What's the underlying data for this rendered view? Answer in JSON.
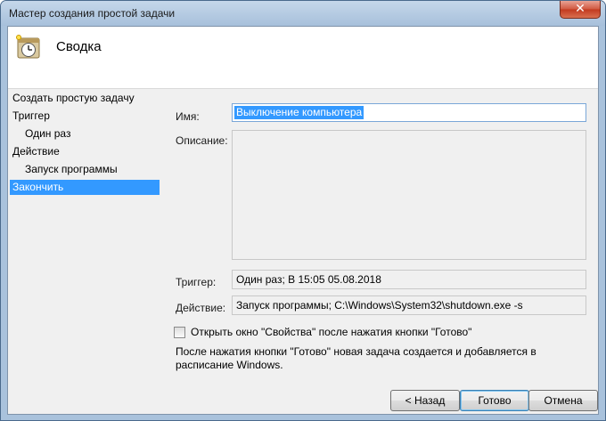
{
  "window": {
    "title": "Мастер создания простой задачи",
    "close_label": "✕"
  },
  "header": {
    "title": "Сводка",
    "icon": "task-scheduler-clock-icon"
  },
  "nav": {
    "items": [
      {
        "label": "Создать простую задачу",
        "level": 0,
        "active": false
      },
      {
        "label": "Триггер",
        "level": 0,
        "active": false
      },
      {
        "label": "Один раз",
        "level": 1,
        "active": false
      },
      {
        "label": "Действие",
        "level": 0,
        "active": false
      },
      {
        "label": "Запуск программы",
        "level": 1,
        "active": false
      },
      {
        "label": "Закончить",
        "level": 0,
        "active": true
      }
    ]
  },
  "summary": {
    "name_label": "Имя:",
    "name_value": "Выключение компьютера",
    "description_label": "Описание:",
    "description_value": "",
    "trigger_label": "Триггер:",
    "trigger_value": "Один раз; В 15:05 05.08.2018",
    "action_label": "Действие:",
    "action_value": "Запуск программы; C:\\Windows\\System32\\shutdown.exe -s"
  },
  "options": {
    "open_properties_label": "Открыть окно \"Свойства\" после нажатия кнопки \"Готово\"",
    "open_properties_checked": false,
    "info_text": "После нажатия кнопки \"Готово\" новая задача создается и добавляется в расписание Windows."
  },
  "buttons": {
    "back": "< Назад",
    "finish": "Готово",
    "cancel": "Отмена"
  },
  "colors": {
    "selection": "#3399ff",
    "titlebar": "#a7c0db",
    "close": "#c2391f"
  }
}
